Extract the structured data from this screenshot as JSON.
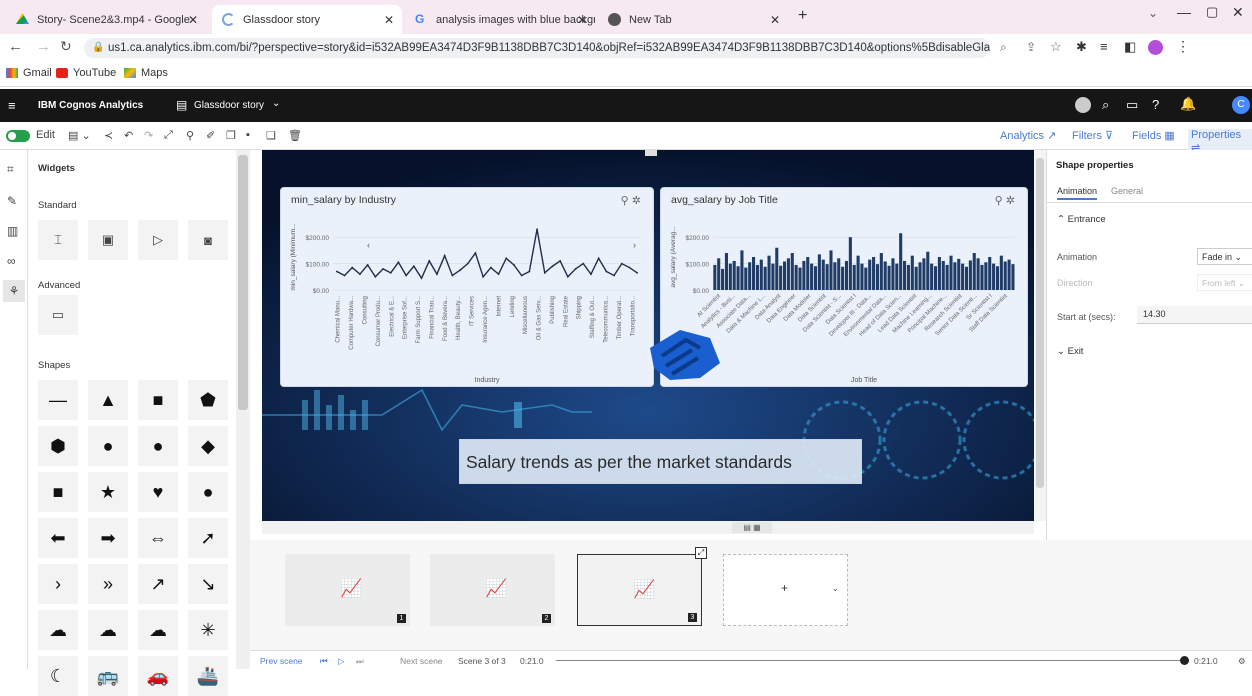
{
  "browser": {
    "tabs": [
      {
        "label": "Story- Scene2&3.mp4 - Google",
        "icon": "drive-icon",
        "color": "#f4b400"
      },
      {
        "label": "Glassdoor story",
        "icon": "cognos-icon",
        "color": "#7aa7e0"
      },
      {
        "label": "analysis images with blue backgr",
        "icon": "google-icon",
        "color": "#4285f4"
      },
      {
        "label": "New Tab",
        "icon": "chrome-icon",
        "color": "#555"
      }
    ],
    "url": "us1.ca.analytics.ibm.com/bi/?perspective=story&id=i532AB99EA3474D3F9B1138DBB7C3D140&objRef=i532AB99EA3474D3F9B1138DBB7C3D140&options%5BdisableGlassPrefetch...",
    "bookmarks": [
      "Gmail",
      "YouTube",
      "Maps"
    ]
  },
  "app": {
    "name": "IBM Cognos Analytics",
    "story_name": "Glassdoor story",
    "avatar_initials": "C"
  },
  "toolbar": {
    "edit_label": "Edit",
    "right_tabs": [
      "Analytics",
      "Filters",
      "Fields",
      "Properties"
    ]
  },
  "widgets_panel": {
    "title": "Widgets",
    "standard_label": "Standard",
    "advanced_label": "Advanced",
    "shapes_label": "Shapes",
    "shapes": [
      "—",
      "▲",
      "■",
      "⬟",
      "⬢",
      "●",
      "●",
      "◆",
      "■",
      "★",
      "♥",
      "●",
      "⬅",
      "➡",
      "⇔",
      "➚",
      "›",
      "»",
      "↗",
      "↘",
      "☁",
      "☁",
      "☁",
      "✳",
      "☾",
      "🚌",
      "🚗",
      "🚢"
    ]
  },
  "charts": [
    {
      "title": "min_salary by Industry",
      "chart_data": {
        "type": "line",
        "title": "min_salary by Industry",
        "xlabel": "Industry",
        "ylabel": "min_salary (Minimum...",
        "ylim": [
          0,
          250
        ],
        "yticks": [
          "$0.00",
          "$100.00",
          "$200.00"
        ],
        "categories": [
          "Chemical Manu...",
          "Computer Hardwa...",
          "Consulting",
          "Consumer Produ...",
          "Electrical & E...",
          "Enterprise Sof...",
          "Farm Support S...",
          "Financial Tran...",
          "Food & Bevera...",
          "Health, Beauty...",
          "IT Services",
          "Insurance Agen...",
          "Internet",
          "Lending",
          "Miscellaneous",
          "Oil & Gas Serv...",
          "Publishing",
          "Real Estate",
          "Shipping",
          "Staffing & Out...",
          "Telecommunica...",
          "Timber Operat...",
          "Transportatio..."
        ],
        "values": [
          70,
          55,
          85,
          60,
          95,
          50,
          80,
          65,
          105,
          55,
          90,
          45,
          110,
          60,
          130,
          55,
          75,
          100,
          140,
          50,
          85,
          60,
          120,
          95,
          55,
          70,
          230,
          65,
          90,
          110,
          50,
          80,
          100,
          60,
          120,
          70,
          55,
          100,
          85,
          65
        ]
      }
    },
    {
      "title": "avg_salary by Job Title",
      "chart_data": {
        "type": "bar",
        "title": "avg_salary by Job Title",
        "xlabel": "Job Title",
        "ylabel": "avg_salary (Averag...",
        "ylim": [
          0,
          250
        ],
        "yticks": [
          "$0.00",
          "$100.00",
          "$200.00"
        ],
        "categories": [
          "AI Scientist",
          "Analytics - Busi...",
          "Associate Data...",
          "Data & Machine L...",
          "Data Analyst",
          "Data Engineer",
          "Data Modeler",
          "Data Scientist",
          "Data Scientist - S...",
          "Data Scientist I",
          "Developer III - Data...",
          "Environmental Data...",
          "Head of Data Scien...",
          "Lead Data Scientist",
          "Machine Learning...",
          "Principal Machine...",
          "Research Scientist",
          "Senior Data Scienti...",
          "Sr Scientist I",
          "Staff Data Scientist"
        ],
        "values": [
          95,
          120,
          80,
          140,
          100,
          110,
          90,
          150,
          85,
          105,
          125,
          95,
          115,
          88,
          130,
          100,
          160,
          92,
          108,
          120,
          140,
          95,
          85,
          110,
          125,
          100,
          90,
          135,
          115,
          98,
          150,
          105,
          120,
          88,
          110,
          200,
          95,
          130,
          100,
          85,
          115,
          125,
          98,
          140,
          108,
          92,
          120,
          100,
          215,
          110,
          95,
          130,
          88,
          105,
          120,
          145,
          100,
          90,
          125,
          110,
          95,
          130,
          105,
          118,
          100,
          88,
          112,
          140,
          120,
          95,
          105,
          125,
          100,
          90,
          130,
          108,
          115,
          98
        ]
      }
    }
  ],
  "caption": "Salary trends as per the market standards",
  "properties": {
    "title": "Shape properties",
    "tabs": [
      "Animation",
      "General"
    ],
    "entrance_label": "Entrance",
    "animation_label": "Animation",
    "animation_value": "Fade in",
    "direction_label": "Direction",
    "direction_value": "From left",
    "start_label": "Start at (secs):",
    "start_value": "14.30",
    "exit_label": "Exit"
  },
  "timeline": {
    "scenes": [
      "1",
      "2",
      "3"
    ],
    "add_label": "+"
  },
  "footer": {
    "prev_label": "Prev scene",
    "next_label": "Next scene",
    "scene_counter": "Scene 3 of 3",
    "time_start": "0:21.0",
    "time_end": "0:21.0"
  }
}
